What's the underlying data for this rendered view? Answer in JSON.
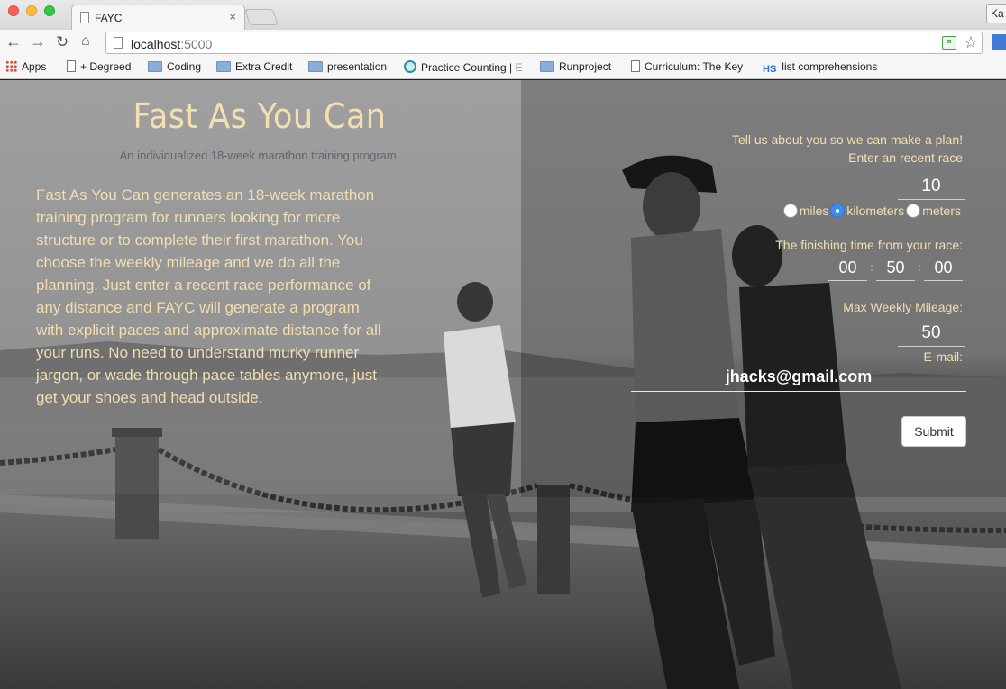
{
  "browser": {
    "tab_title": "FAYC",
    "tab_close": "×",
    "profile_label": "Ka",
    "url_host": "localhost",
    "url_port": ":5000",
    "nav": {
      "back": "←",
      "forward": "→",
      "reload": "↻",
      "home": "⌂",
      "star": "☆"
    },
    "bookmarks": [
      {
        "label": "Apps",
        "icon": "apps-grid-icon"
      },
      {
        "label": "+ Degreed",
        "icon": "page-icon"
      },
      {
        "label": "Coding",
        "icon": "folder-icon"
      },
      {
        "label": "Extra Credit",
        "icon": "folder-icon"
      },
      {
        "label": "presentation",
        "icon": "folder-icon"
      },
      {
        "label": "Practice Counting | ",
        "suffix": "E",
        "icon": "globe-icon"
      },
      {
        "label": "Runproject",
        "icon": "folder-icon"
      },
      {
        "label": "Curriculum: The Key",
        "icon": "page-icon"
      },
      {
        "label": "list comprehensions",
        "prefix": "HS",
        "icon": "hs-icon"
      }
    ]
  },
  "hero": {
    "title": "Fast As You Can",
    "subtitle": "An individualized 18-week marathon training program.",
    "description": "Fast As You Can generates an 18-week marathon training program for runners looking for more structure or to complete their first marathon. You choose the weekly mileage and we do all the planning. Just enter a recent race performance of any distance and FAYC will generate a program with explicit paces and approximate distance for all your runs. No need to understand murky runner jargon, or wade through pace tables anymore, just get your shoes and head outside."
  },
  "form": {
    "intro": "Tell us about you so we can make a plan!",
    "race_label": "Enter an recent race",
    "race_value": "10",
    "units": [
      {
        "label": "miles",
        "checked": false
      },
      {
        "label": "kilometers",
        "checked": true
      },
      {
        "label": "meters",
        "checked": false
      }
    ],
    "time_label": "The finishing time from your race:",
    "time_hours": "00",
    "time_minutes": "50",
    "time_seconds": "00",
    "time_sep": ":",
    "mileage_label": "Max Weekly Mileage:",
    "mileage_value": "50",
    "email_label": "E-mail:",
    "email_value": "jhacks@gmail.com",
    "submit_label": "Submit"
  }
}
